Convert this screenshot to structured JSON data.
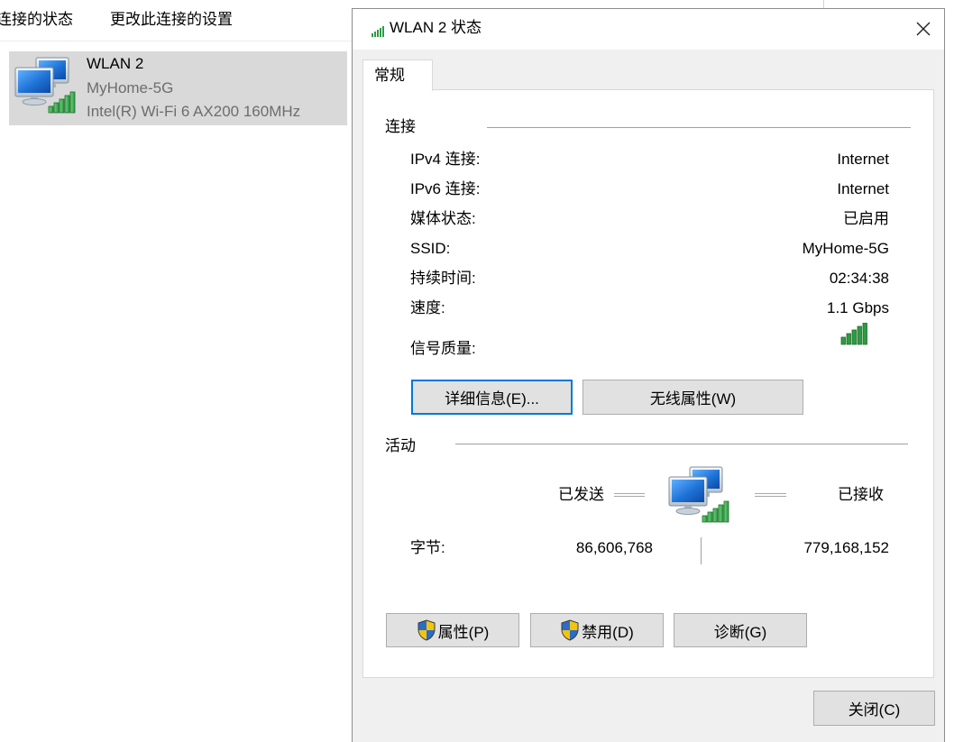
{
  "explorer": {
    "toolbar": {
      "view_status": "连接的状态",
      "change_settings": "更改此连接的设置"
    },
    "connection": {
      "name": "WLAN 2",
      "network": "MyHome-5G",
      "adapter": "Intel(R) Wi-Fi 6 AX200 160MHz",
      "icon": "network-computers-icon"
    }
  },
  "dialog": {
    "title": "WLAN 2 状态",
    "title_icon": "signal-bars-icon",
    "close_icon": "close-icon",
    "tabs": [
      {
        "label": "常规",
        "selected": true
      }
    ],
    "connection": {
      "heading": "连接",
      "rows": [
        {
          "label": "IPv4 连接:",
          "value": "Internet"
        },
        {
          "label": "IPv6 连接:",
          "value": "Internet"
        },
        {
          "label": "媒体状态:",
          "value": "已启用"
        },
        {
          "label": "SSID:",
          "value": "MyHome-5G"
        },
        {
          "label": "持续时间:",
          "value": "02:34:38"
        },
        {
          "label": "速度:",
          "value": "1.1 Gbps"
        }
      ],
      "signal_label": "信号质量:",
      "signal_level": 5,
      "signal_max": 5
    },
    "buttons": {
      "details": "详细信息(E)...",
      "wireless": "无线属性(W)"
    },
    "activity": {
      "heading": "活动",
      "sent_label": "已发送",
      "received_label": "已接收",
      "bytes_label": "字节:",
      "bytes_sent": "86,606,768",
      "bytes_received": "779,168,152",
      "icon": "network-computers-icon"
    },
    "actions": [
      {
        "label": "属性(P)",
        "icon": "uac-shield-icon"
      },
      {
        "label": "禁用(D)",
        "icon": "uac-shield-icon"
      },
      {
        "label": "诊断(G)"
      }
    ],
    "close_label": "关闭(C)"
  },
  "colors": {
    "accent": "#0078d7",
    "selection": "#d9d9d9",
    "signal_green": "#2e9b43",
    "signal_empty": "#cfcfcf",
    "secondary_text": "#6d6d6d",
    "dialog_face": "#f0f0f0"
  }
}
